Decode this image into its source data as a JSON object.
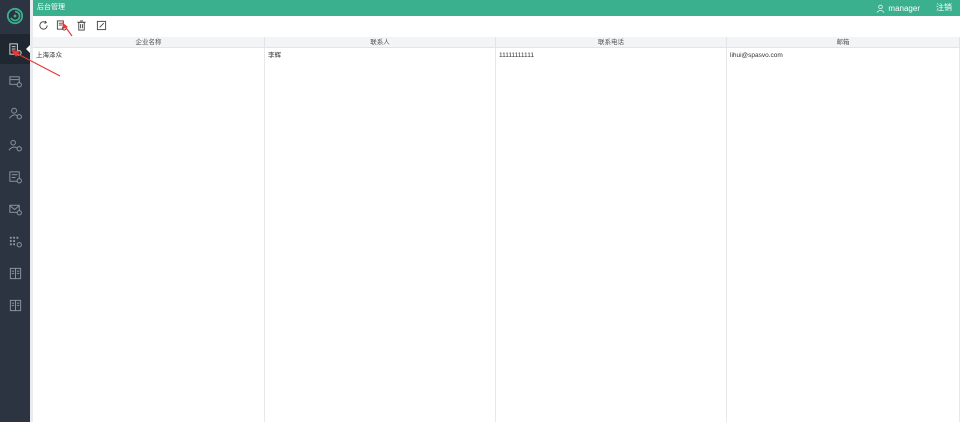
{
  "app": {
    "title": "后台管理",
    "user": "manager",
    "logout_label": "注销",
    "accent_color": "#3ab08f",
    "sidebar_color": "#2b3440"
  },
  "sidebar": {
    "items": [
      {
        "icon": "enterprise-settings-icon",
        "active": true
      },
      {
        "icon": "card-settings-icon",
        "active": false
      },
      {
        "icon": "user-settings-icon",
        "active": false
      },
      {
        "icon": "group-settings-icon",
        "active": false
      },
      {
        "icon": "document-settings-icon",
        "active": false
      },
      {
        "icon": "mail-settings-icon",
        "active": false
      },
      {
        "icon": "grid-settings-icon",
        "active": false
      },
      {
        "icon": "book-icon",
        "active": false
      },
      {
        "icon": "book-icon",
        "active": false
      }
    ]
  },
  "toolbar": {
    "buttons": [
      {
        "icon": "refresh-icon"
      },
      {
        "icon": "add-document-icon"
      },
      {
        "icon": "delete-icon"
      },
      {
        "icon": "edit-icon"
      }
    ]
  },
  "table": {
    "columns": [
      "企业名称",
      "联系人",
      "联系电话",
      "邮箱"
    ],
    "rows": [
      [
        "上海泽众",
        "李辉",
        "11111111111",
        "lihui@spasvo.com"
      ]
    ]
  }
}
